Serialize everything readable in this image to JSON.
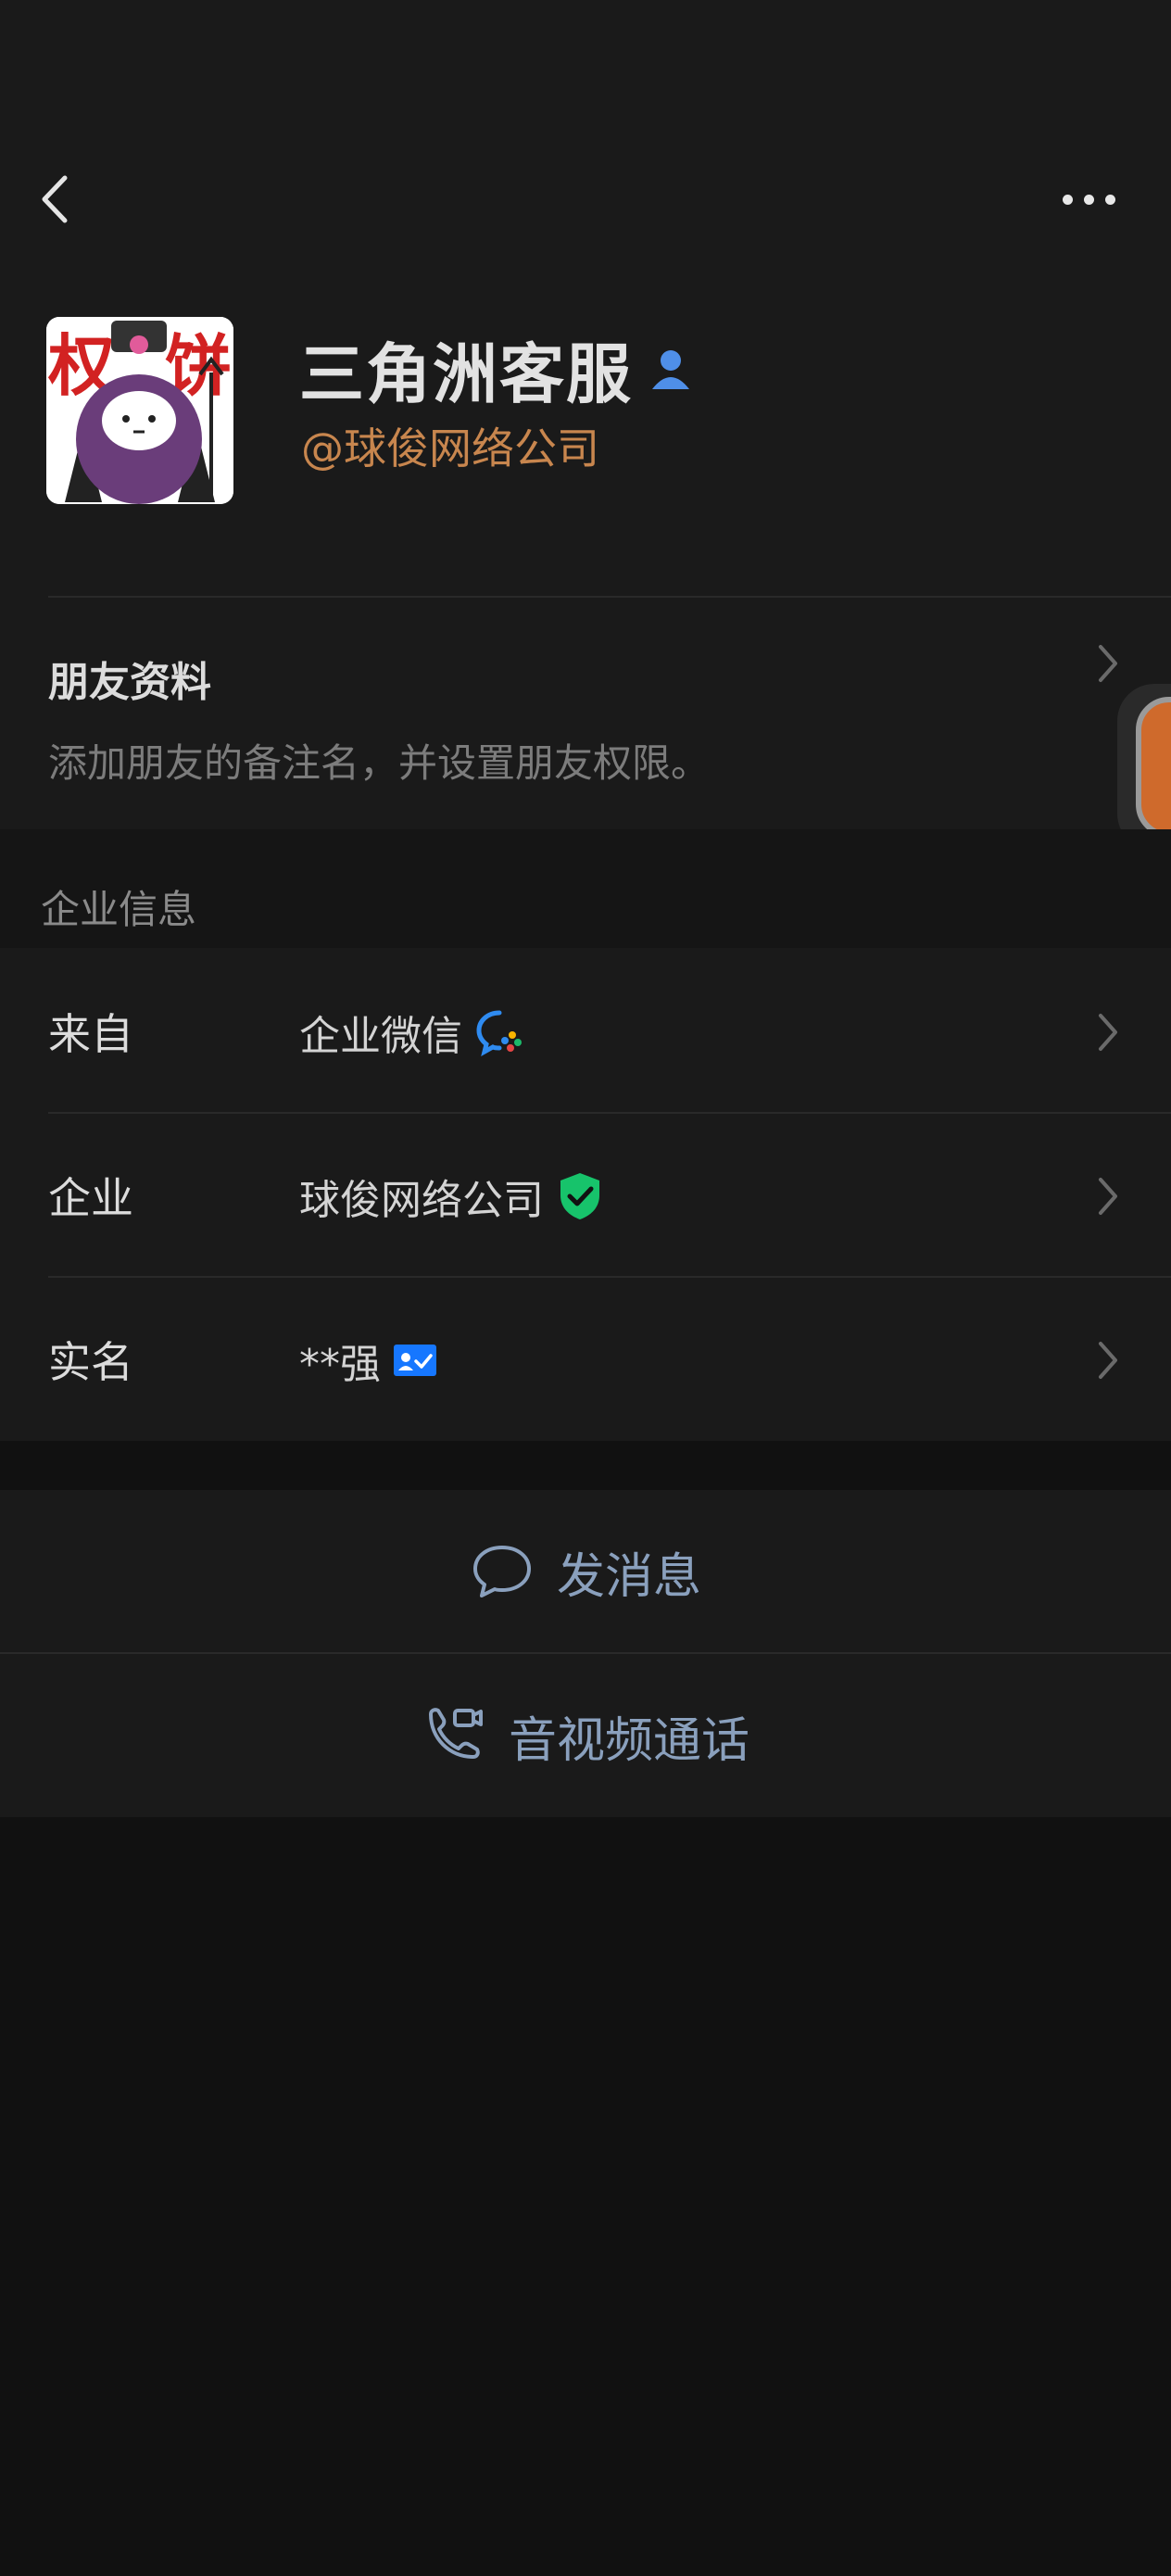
{
  "nav": {
    "back_icon": "chevron-left-icon",
    "more_icon": "more-dots-icon"
  },
  "profile": {
    "name": "三角洲客服",
    "name_badge_icon": "person-icon",
    "corp_link": "@球俊网络公司",
    "avatar_logo_text": "权 饼"
  },
  "friend": {
    "title": "朋友资料",
    "subtitle": "添加朋友的备注名，并设置朋友权限。"
  },
  "enterprise": {
    "section_title": "企业信息",
    "rows": [
      {
        "label": "来自",
        "value": "企业微信",
        "icon": "wecom-icon"
      },
      {
        "label": "企业",
        "value": "球俊网络公司",
        "icon": "verified-shield-icon"
      },
      {
        "label": "实名",
        "value": "**强",
        "icon": "id-card-icon"
      }
    ]
  },
  "actions": {
    "message": "发消息",
    "call": "音视频通话"
  },
  "colors": {
    "page_bg": "#111111",
    "card_bg": "#1a1a1a",
    "accent_orange": "#c8864e",
    "link_blue": "#8aa0bd",
    "verified_green": "#17c36b",
    "badge_blue": "#1677ff"
  }
}
